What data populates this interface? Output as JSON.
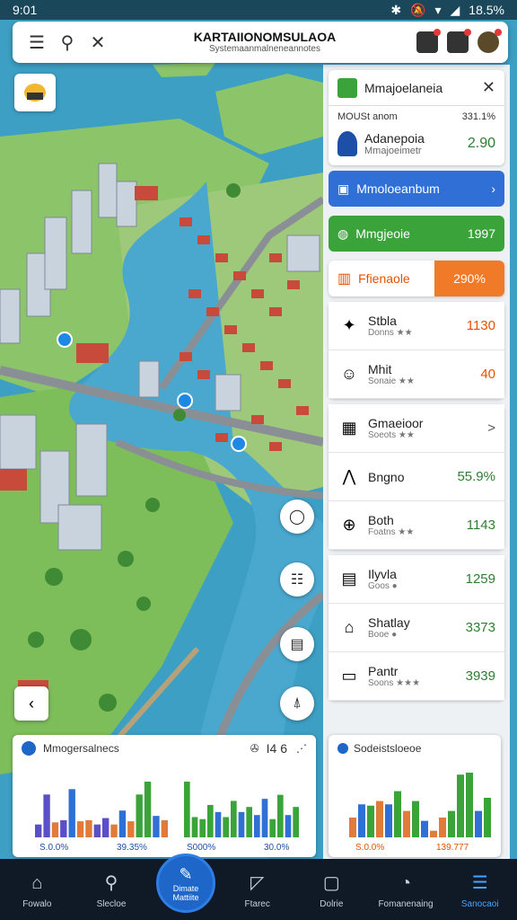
{
  "status_bar": {
    "time": "9:01",
    "battery": "18.5%"
  },
  "header": {
    "title": "KARTAIIONOMSULAOA",
    "subtitle": "Systemaanmalneneannotes"
  },
  "panel": {
    "header_name": "Mmajoelaneia",
    "sub_label": "MOUSt anom",
    "sub_value": "331.1%",
    "main_title": "Adanepoia",
    "main_sub": "Mmajoeimetr",
    "main_value": "2.90",
    "buttons": [
      {
        "label": "Mmoloeanbum",
        "value": "",
        "color": "#2f6fd6"
      },
      {
        "label": "Mmgjeoie",
        "value": "1997",
        "color": "#3aa33a"
      }
    ],
    "orange_row": {
      "label": "Ffienaole",
      "value": "290%"
    },
    "rows_a": [
      {
        "title": "Stbla",
        "sub": "Donns ★★",
        "value": "1130",
        "icon": "compass-icon",
        "value_color": "#e65100"
      },
      {
        "title": "Mhit",
        "sub": "Sonaie ★★",
        "value": "40",
        "icon": "face-icon",
        "value_color": "#e65100"
      }
    ],
    "rows_b": [
      {
        "title": "Gmaeioor",
        "sub": "Soeots ★★",
        "value": ">",
        "icon": "book-icon",
        "value_color": "#555555"
      },
      {
        "title": "Bngno",
        "sub": "",
        "value": "55.9%",
        "icon": "chart-icon",
        "value_color": "#2e7d32"
      },
      {
        "title": "Both",
        "sub": "Foatns ★★",
        "value": "1143",
        "icon": "globe-icon",
        "value_color": "#2e7d32"
      }
    ],
    "rows_c": [
      {
        "title": "Ilyvla",
        "sub": "Goos ●",
        "value": "1259",
        "icon": "layers-icon",
        "value_color": "#2e7d32"
      },
      {
        "title": "Shatlay",
        "sub": "Booe ●",
        "value": "3373",
        "icon": "home-icon",
        "value_color": "#2e7d32"
      },
      {
        "title": "Pantr",
        "sub": "Soons ★★★",
        "value": "3939",
        "icon": "document-icon",
        "value_color": "#2e7d32"
      }
    ]
  },
  "chart_left": {
    "title": "Mmogersalnecs",
    "controls": "I4 6",
    "left_min": "S.0.0%",
    "left_max": "39.35%",
    "right_min": "S000%",
    "right_max": "30.0%"
  },
  "chart_right": {
    "title": "Sodeistsloeoe",
    "min": "S.0.0%",
    "max": "139.777"
  },
  "chart_data": [
    {
      "type": "bar",
      "values": [
        12,
        40,
        14,
        16,
        45,
        15,
        16,
        12,
        18,
        12,
        25,
        15,
        40,
        52,
        20,
        16
      ],
      "colors": [
        "#5b4fc7",
        "#5b4fc7",
        "#e07b39",
        "#5b4fc7",
        "#2f6fd6",
        "#e07b39",
        "#e07b39",
        "#5b4fc7",
        "#5b4fc7",
        "#e07b39",
        "#2f6fd6",
        "#e07b39",
        "#3aa33a",
        "#3aa33a",
        "#2f6fd6",
        "#e07b39"
      ]
    },
    {
      "type": "bar",
      "values": [
        55,
        20,
        18,
        32,
        25,
        20,
        36,
        25,
        30,
        22,
        38,
        18,
        42,
        22,
        30
      ],
      "colors": [
        "#3aa33a",
        "#3aa33a",
        "#3aa33a",
        "#3aa33a",
        "#2f6fd6",
        "#3aa33a",
        "#3aa33a",
        "#2f6fd6",
        "#3aa33a",
        "#2f6fd6",
        "#2f6fd6",
        "#3aa33a",
        "#3aa33a",
        "#2f6fd6",
        "#3aa33a"
      ]
    },
    {
      "type": "bar",
      "values": [
        30,
        50,
        48,
        55,
        50,
        70,
        40,
        55,
        25,
        10,
        30,
        40,
        95,
        98,
        40,
        60
      ],
      "colors": [
        "#e07b39",
        "#2f6fd6",
        "#3aa33a",
        "#e07b39",
        "#2f6fd6",
        "#3aa33a",
        "#e07b39",
        "#3aa33a",
        "#2f6fd6",
        "#e07b39",
        "#e07b39",
        "#3aa33a",
        "#3aa33a",
        "#3aa33a",
        "#2f6fd6",
        "#3aa33a"
      ]
    }
  ],
  "bottom_nav": [
    {
      "label": "Fowalo",
      "icon": "home-icon",
      "active": false
    },
    {
      "label": "Slecloe",
      "icon": "search-icon",
      "active": false
    },
    {
      "label": "Ftarec",
      "icon": "chart-icon",
      "active": false
    },
    {
      "label": "Dolrie",
      "icon": "map-icon",
      "active": false
    },
    {
      "label": "Fomanenaing",
      "icon": "alert-icon",
      "active": false
    },
    {
      "label": "Sanocaoi",
      "icon": "menu-icon",
      "active": true
    }
  ],
  "center_fab": {
    "line1": "Dimate",
    "line2": "Mattiite"
  }
}
